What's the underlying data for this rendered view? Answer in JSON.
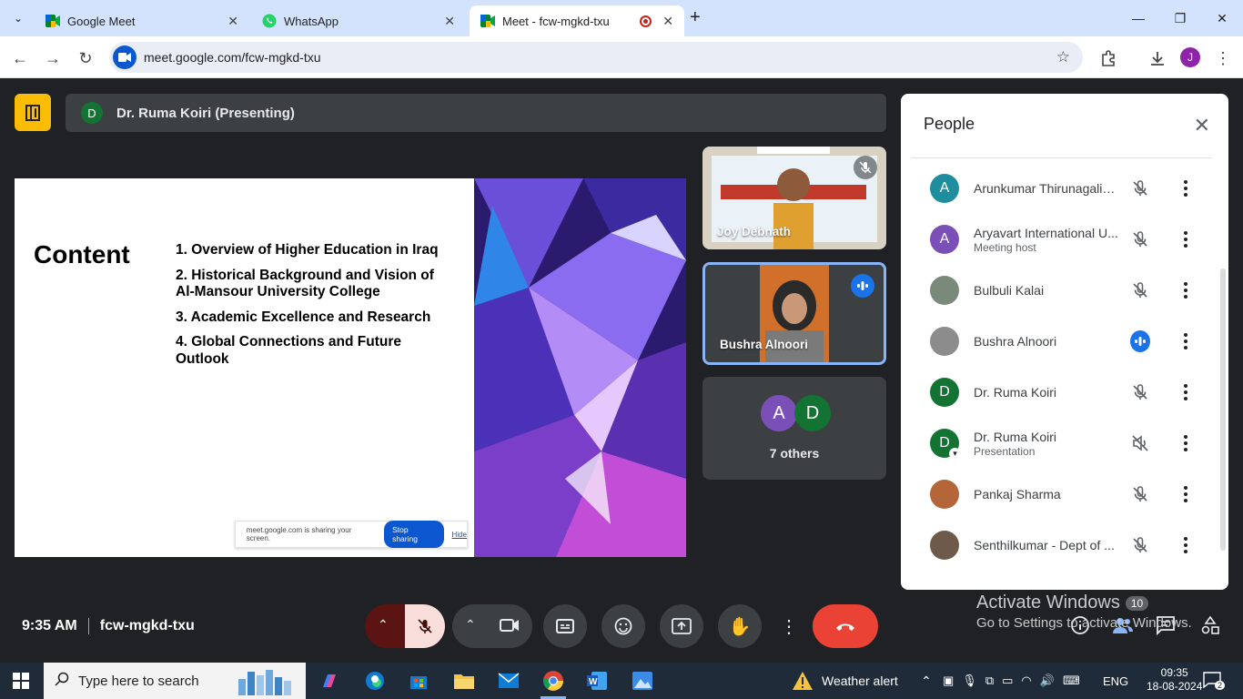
{
  "browser": {
    "tabs": [
      {
        "title": "Google Meet",
        "icon": "meet-icon"
      },
      {
        "title": "WhatsApp",
        "icon": "whatsapp-icon"
      },
      {
        "title": "Meet - fcw-mgkd-txu",
        "icon": "meet-icon",
        "recording": true
      }
    ],
    "url": "meet.google.com/fcw-mgkd-txu",
    "profile_initial": "J"
  },
  "meet": {
    "presenter_initial": "D",
    "presenting_label": "Dr. Ruma Koiri (Presenting)",
    "slide": {
      "heading": "Content",
      "items": [
        "1. Overview of Higher Education in Iraq",
        "2. Historical Background and Vision of Al-Mansour University College",
        "3. Academic Excellence and Research",
        "4. Global Connections and Future Outlook"
      ],
      "share_bar": {
        "text": "meet.google.com is sharing your screen.",
        "stop": "Stop sharing",
        "hide": "Hide"
      }
    },
    "tiles": [
      {
        "name": "Joy Debnath",
        "muted": true
      },
      {
        "name": "Bushra Alnoori",
        "speaking": true
      },
      {
        "others_initials": [
          "A",
          "D"
        ],
        "others_label": "7 others"
      }
    ],
    "time": "9:35 AM",
    "meeting_code": "fcw-mgkd-txu"
  },
  "people_panel": {
    "title": "People",
    "participants": [
      {
        "initial": "A",
        "name": "Arunkumar Thirunagalin...",
        "sub": "",
        "color": "#1e8e9e",
        "mic": "muted"
      },
      {
        "initial": "A",
        "name": "Aryavart International U...",
        "sub": "Meeting host",
        "color": "#7b4fb8",
        "mic": "muted"
      },
      {
        "initial": "",
        "name": "Bulbuli Kalai",
        "sub": "",
        "color": "#7a8a7a",
        "mic": "muted"
      },
      {
        "initial": "",
        "name": "Bushra Alnoori",
        "sub": "",
        "color": "#8c8c8c",
        "mic": "speaking"
      },
      {
        "initial": "D",
        "name": "Dr. Ruma Koiri",
        "sub": "",
        "color": "#137333",
        "mic": "muted"
      },
      {
        "initial": "D",
        "name": "Dr. Ruma Koiri",
        "sub": "Presentation",
        "color": "#137333",
        "mic": "volume-off"
      },
      {
        "initial": "",
        "name": "Pankaj Sharma",
        "sub": "",
        "color": "#b5653a",
        "mic": "muted"
      },
      {
        "initial": "",
        "name": "Senthilkumar - Dept of ...",
        "sub": "",
        "color": "#6d5a4a",
        "mic": "muted"
      }
    ]
  },
  "watermark": {
    "line1": "Activate Windows",
    "line2": "Go to Settings to activate Windows.",
    "count": "10"
  },
  "taskbar": {
    "search_placeholder": "Type here to search",
    "weather": "Weather alert",
    "lang": "ENG",
    "time": "09:35",
    "date": "18-08-2024",
    "notifications": "2"
  }
}
